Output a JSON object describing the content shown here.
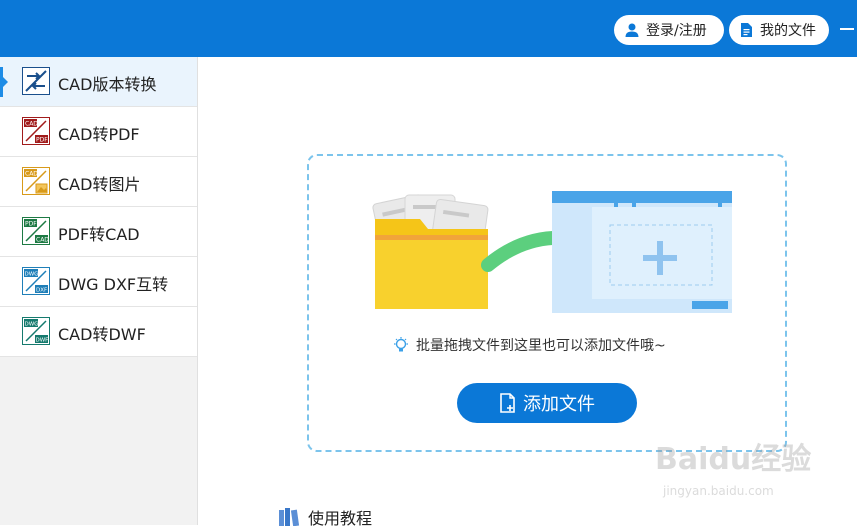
{
  "header": {
    "login_label": "登录/注册",
    "my_files_label": "我的文件",
    "accent_color": "#0b78d7"
  },
  "sidebar": {
    "items": [
      {
        "label": "CAD版本转换",
        "icon": "cad-version-icon",
        "active": true
      },
      {
        "label": "CAD转PDF",
        "icon": "cad-to-pdf-icon",
        "active": false
      },
      {
        "label": "CAD转图片",
        "icon": "cad-to-image-icon",
        "active": false
      },
      {
        "label": "PDF转CAD",
        "icon": "pdf-to-cad-icon",
        "active": false
      },
      {
        "label": "DWG DXF互转",
        "icon": "dwg-dxf-icon",
        "active": false
      },
      {
        "label": "CAD转DWF",
        "icon": "cad-to-dwf-icon",
        "active": false
      }
    ]
  },
  "dropzone": {
    "hint": "批量拖拽文件到这里也可以添加文件哦~",
    "add_button_label": "添加文件"
  },
  "tutorial": {
    "label": "使用教程"
  },
  "watermark": {
    "main": "Baidu经验",
    "sub": "jingyan.baidu.com"
  }
}
